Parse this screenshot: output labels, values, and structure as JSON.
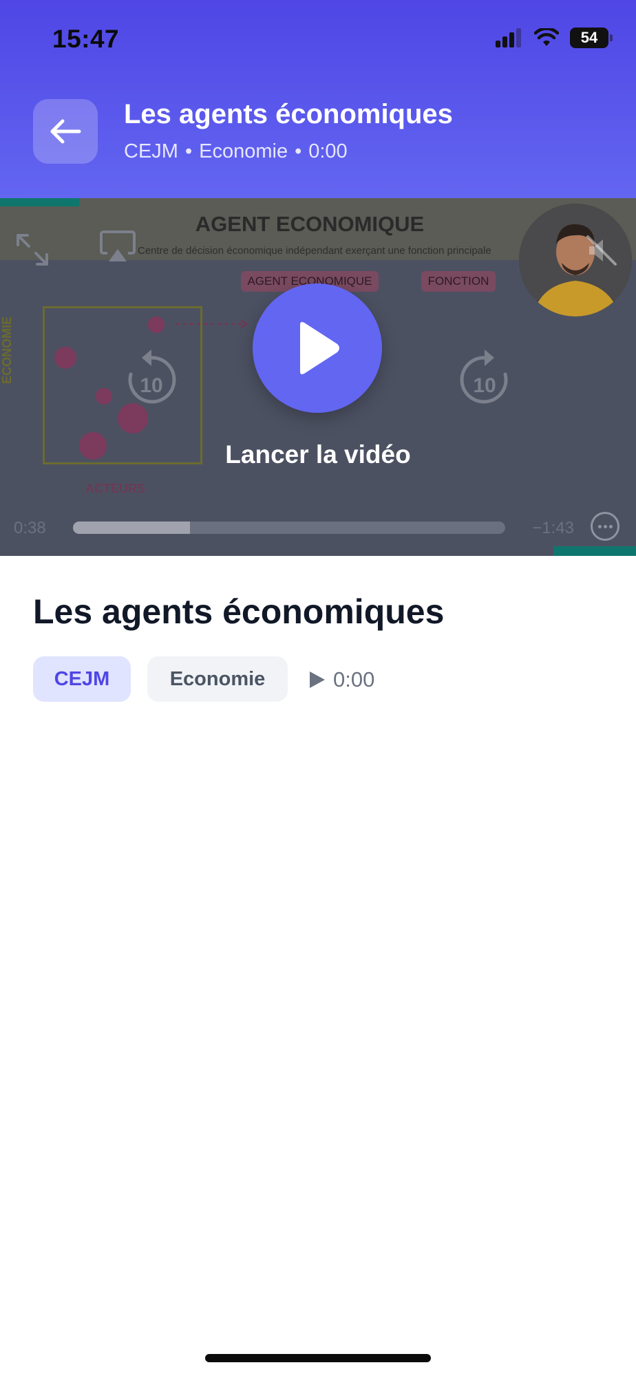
{
  "status_bar": {
    "time": "15:47",
    "battery": "54"
  },
  "header": {
    "title": "Les agents économiques",
    "subject": "CEJM",
    "topic": "Economie",
    "duration": "0:00"
  },
  "video": {
    "slide": {
      "title": "AGENT ECONOMIQUE",
      "subtitle": "Centre de décision économique indépendant exerçant une fonction principale",
      "tag_agent": "AGENT ECONOMIQUE",
      "tag_function": "FONCTION",
      "axis_y": "ECONOMIE",
      "axis_x": "ACTEURS"
    },
    "skip_back": "10",
    "skip_forward": "10",
    "play_label": "Lancer la vidéo",
    "elapsed": "0:38",
    "remaining": "−1:43",
    "progress": 0.27
  },
  "lesson": {
    "title": "Les agents économiques",
    "subject_chip": "CEJM",
    "topic_chip": "Economie",
    "duration": "0:00"
  },
  "colors": {
    "accent": "#6366f1",
    "header_top": "#4f46e5"
  },
  "icons": [
    "signal-icon",
    "wifi-icon",
    "battery-icon",
    "back-arrow-icon",
    "fullscreen-icon",
    "airplay-icon",
    "replay-10-icon",
    "forward-10-icon",
    "play-icon",
    "mute-icon",
    "more-icon"
  ]
}
